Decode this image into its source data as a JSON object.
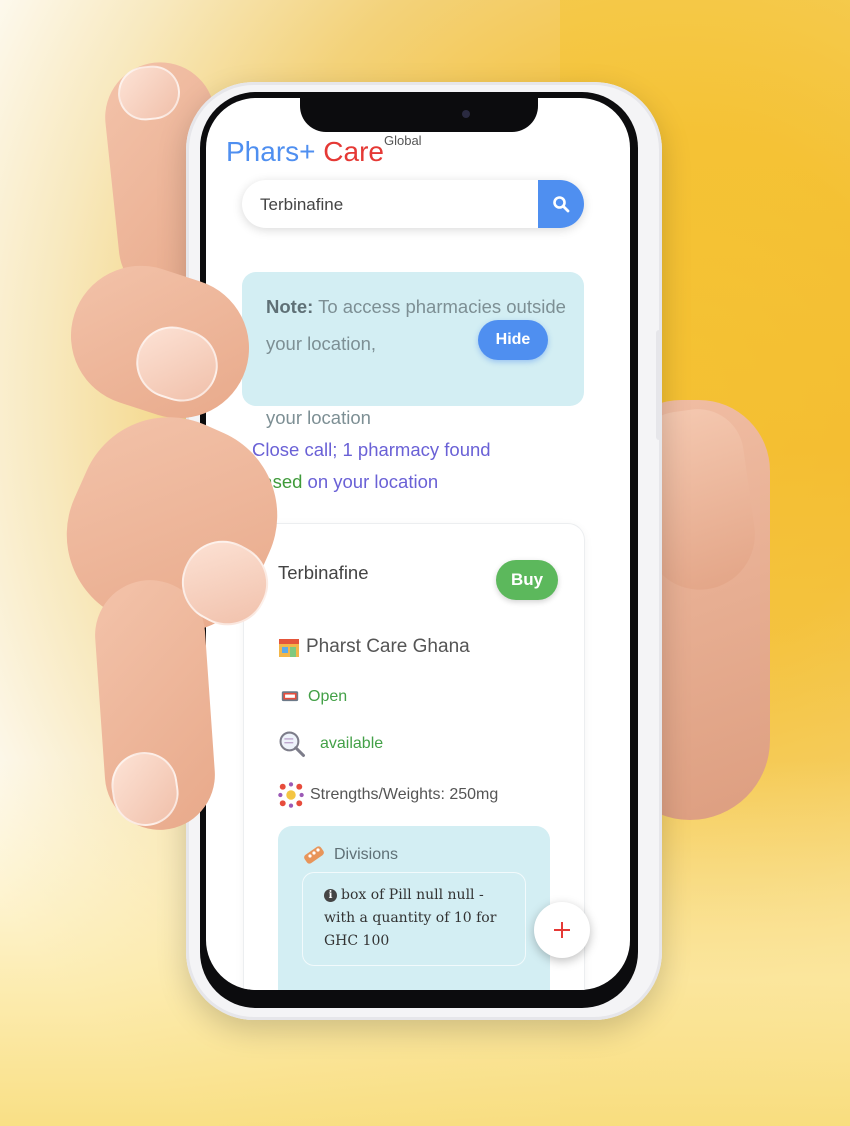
{
  "brand": {
    "part1": "Phars+",
    "part2": "Care",
    "superscript": "Global"
  },
  "search": {
    "value": "Terbinafine",
    "icon": "search-icon"
  },
  "note": {
    "label": "Note:",
    "text_before": " To access pharmacies outside your location,",
    "hide_label": "Hide",
    "text_after": "your location"
  },
  "results": {
    "line1": "Close call; 1 pharmacy found",
    "based": "based",
    "line2_rest": " on your location"
  },
  "card": {
    "drug_name": "Terbinafine",
    "buy_label": "Buy",
    "pharmacy_name": "Pharst Care Ghana",
    "status": "Open",
    "availability": "available",
    "strengths": "Strengths/Weights: 250mg",
    "divisions_label": "Divisions",
    "division_item": "box of Pill null null - with a quantity of 10 for GHC 100"
  },
  "fab_label": "+",
  "colors": {
    "accent": "#4f8ff0",
    "brand_red": "#e53935",
    "success": "#5cb85c",
    "note_bg": "#d3eef3"
  }
}
